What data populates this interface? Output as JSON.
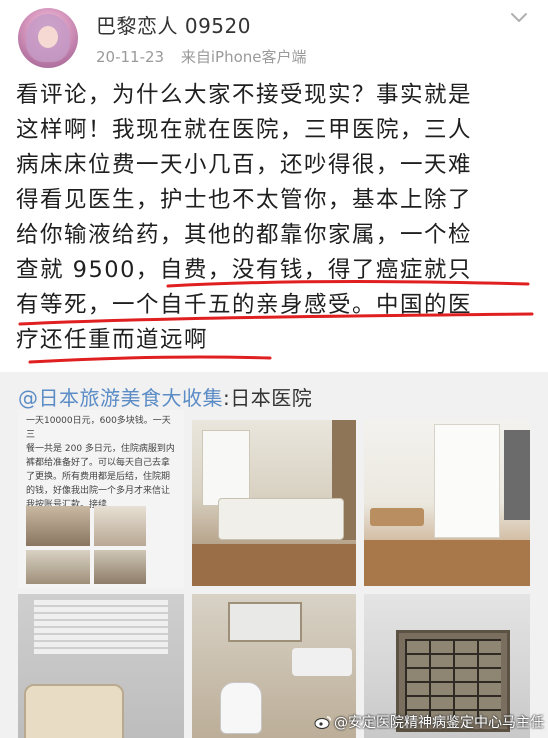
{
  "header": {
    "username": "巴黎恋人 09520",
    "date": "20-11-23",
    "source": "来自iPhone客户端"
  },
  "post": {
    "lines": [
      "看评论，为什么大家不接受现实？事实就是",
      "这样啊！我现在就在医院，三甲医院，三人",
      "病床床位费一天小几百，还吵得很，一天难",
      "得看见医生，护士也不太管你，基本上除了",
      "给你输液给药，其他的都靠你家属，一个检",
      "查就 9500，自费，没有钱，得了癌症就只",
      "有等死，一个自千五的亲身感受。中国的医",
      "疗还任重而道远啊"
    ]
  },
  "repost": {
    "author": "@日本旅游美食大收集",
    "separator": ":",
    "text": "日本医院",
    "thumb_text": [
      "一天10000日元，600多块钱。一天三",
      "餐一共是 200 多日元，住院病服到内",
      "裤都给准备好了。可以每天自己去拿",
      "了更换。所有费用都是后结，住院期",
      "的钱，好像我出院一个多月才来信让",
      "我按账号汇款。接续"
    ]
  },
  "watermark": "@安定医院精神病鉴定中心马主任",
  "colors": {
    "link": "#5b8cc6",
    "underline": "#e02020",
    "background": "#ffffff",
    "repost_bg": "#f1f1f1"
  },
  "icons": {
    "more": "chevron-down-icon",
    "weibo": "weibo-logo-icon"
  }
}
